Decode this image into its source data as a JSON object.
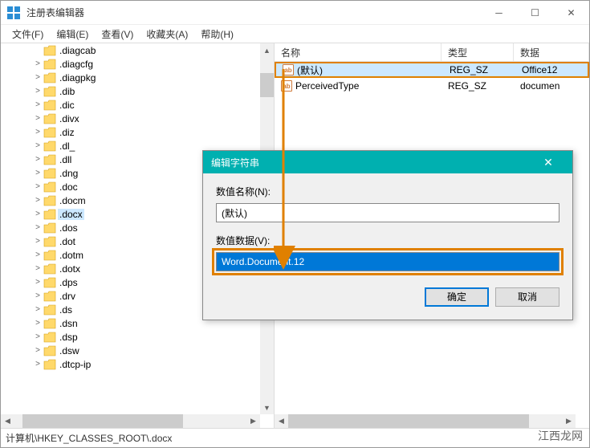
{
  "window": {
    "title": "注册表编辑器",
    "controls": {
      "min": "─",
      "max": "☐",
      "close": "✕"
    }
  },
  "menu": {
    "file": "文件(F)",
    "edit": "编辑(E)",
    "view": "查看(V)",
    "favorites": "收藏夹(A)",
    "help": "帮助(H)"
  },
  "tree": {
    "items": [
      {
        "label": ".diagcab",
        "expander": ""
      },
      {
        "label": ".diagcfg",
        "expander": ">"
      },
      {
        "label": ".diagpkg",
        "expander": ">"
      },
      {
        "label": ".dib",
        "expander": ">"
      },
      {
        "label": ".dic",
        "expander": ">"
      },
      {
        "label": ".divx",
        "expander": ">"
      },
      {
        "label": ".diz",
        "expander": ">"
      },
      {
        "label": ".dl_",
        "expander": ">"
      },
      {
        "label": ".dll",
        "expander": ">"
      },
      {
        "label": ".dng",
        "expander": ">"
      },
      {
        "label": ".doc",
        "expander": ">"
      },
      {
        "label": ".docm",
        "expander": ">"
      },
      {
        "label": ".docx",
        "expander": ">",
        "selected": true
      },
      {
        "label": ".dos",
        "expander": ">"
      },
      {
        "label": ".dot",
        "expander": ">"
      },
      {
        "label": ".dotm",
        "expander": ">"
      },
      {
        "label": ".dotx",
        "expander": ">"
      },
      {
        "label": ".dps",
        "expander": ">"
      },
      {
        "label": ".drv",
        "expander": ">"
      },
      {
        "label": ".ds",
        "expander": ">"
      },
      {
        "label": ".dsn",
        "expander": ">"
      },
      {
        "label": ".dsp",
        "expander": ">"
      },
      {
        "label": ".dsw",
        "expander": ">"
      },
      {
        "label": ".dtcp-ip",
        "expander": ">"
      }
    ]
  },
  "list": {
    "columns": {
      "name": "名称",
      "type": "类型",
      "data": "数据"
    },
    "rows": [
      {
        "name": "(默认)",
        "type": "REG_SZ",
        "data": "Office12",
        "highlighted": true
      },
      {
        "name": "PerceivedType",
        "type": "REG_SZ",
        "data": "documen"
      }
    ]
  },
  "dialog": {
    "title": "编辑字符串",
    "name_label": "数值名称(N):",
    "name_value": "(默认)",
    "data_label": "数值数据(V):",
    "data_value": "Word.Document.12",
    "ok": "确定",
    "cancel": "取消"
  },
  "status": {
    "path": "计算机\\HKEY_CLASSES_ROOT\\.docx"
  },
  "watermark": "江西龙网"
}
